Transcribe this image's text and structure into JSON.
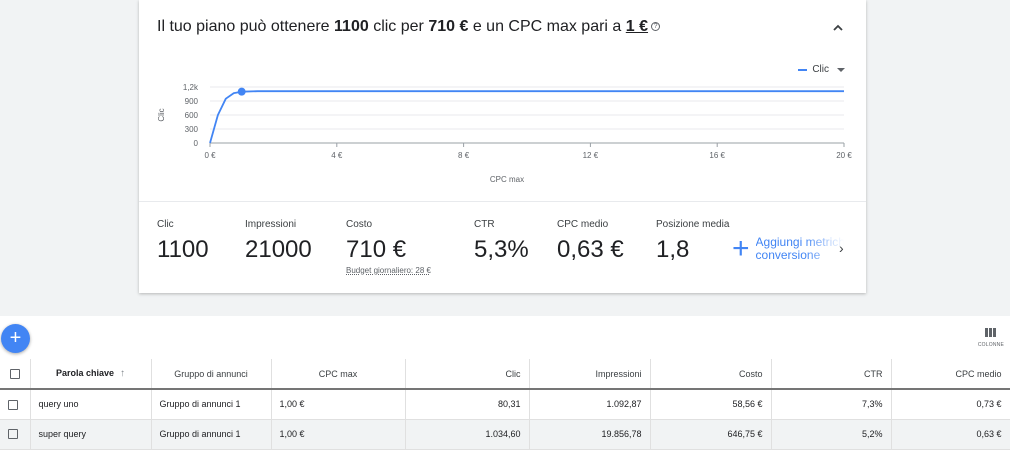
{
  "plan": {
    "title_prefix": "Il tuo piano può ottenere ",
    "clicks": "1100",
    "title_mid1": " clic per ",
    "cost": "710 €",
    "title_mid2": " e un CPC max pari a ",
    "cpc_max": "1 €",
    "help_icon": "?"
  },
  "legend": {
    "label": "Clic",
    "color": "#4285f4"
  },
  "chart_data": {
    "type": "line",
    "title": "",
    "xlabel": "CPC max",
    "ylabel": "Clic",
    "xlim": [
      0,
      20
    ],
    "ylim": [
      0,
      1200
    ],
    "x_ticks": [
      "0 €",
      "4 €",
      "8 €",
      "12 €",
      "16 €",
      "20 €"
    ],
    "x_tick_values": [
      0,
      4,
      8,
      12,
      16,
      20
    ],
    "y_ticks": [
      "0",
      "300",
      "600",
      "900",
      "1,2k"
    ],
    "y_tick_values": [
      0,
      300,
      600,
      900,
      1200
    ],
    "grid": true,
    "series": [
      {
        "name": "Clic",
        "x": [
          0,
          0.25,
          0.5,
          0.75,
          1,
          1.5,
          2,
          4,
          8,
          12,
          16,
          20
        ],
        "y": [
          0,
          600,
          950,
          1070,
          1100,
          1110,
          1110,
          1110,
          1110,
          1110,
          1110,
          1110
        ]
      }
    ],
    "highlight_point": {
      "x": 1,
      "y": 1100
    }
  },
  "metrics": [
    {
      "label": "Clic",
      "value": "1100"
    },
    {
      "label": "Impressioni",
      "value": "21000"
    },
    {
      "label": "Costo",
      "value": "710 €",
      "sub": "Budget giornaliero: 28 €"
    },
    {
      "label": "CTR",
      "value": "5,3%"
    },
    {
      "label": "CPC medio",
      "value": "0,63 €"
    },
    {
      "label": "Posizione media",
      "value": "1,8"
    }
  ],
  "add_conversions": {
    "line1": "Aggiungi metriche",
    "line2": "conversione"
  },
  "toolbar": {
    "columns_label": "COLONNE",
    "fab": "+"
  },
  "table": {
    "headers": [
      "Parola chiave",
      "Gruppo di annunci",
      "CPC max",
      "Clic",
      "Impressioni",
      "Costo",
      "CTR",
      "CPC medio"
    ],
    "sort_arrow": "↑",
    "rows": [
      [
        "query uno",
        "Gruppo di annunci 1",
        "1,00 €",
        "80,31",
        "1.092,87",
        "58,56 €",
        "7,3%",
        "0,73 €"
      ],
      [
        "super query",
        "Gruppo di annunci 1",
        "1,00 €",
        "1.034,60",
        "19.856,78",
        "646,75 €",
        "5,2%",
        "0,63 €"
      ]
    ]
  }
}
